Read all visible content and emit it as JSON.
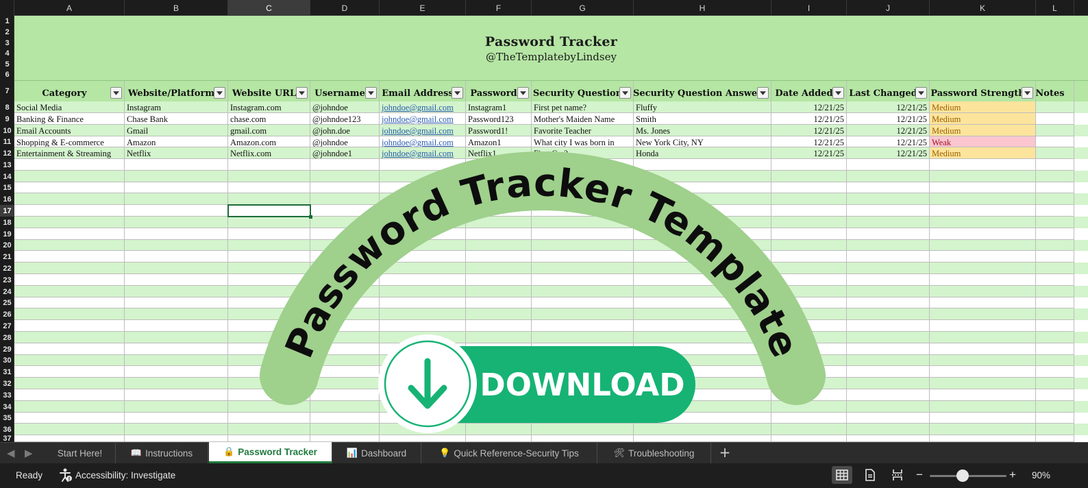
{
  "columns": [
    "A",
    "B",
    "C",
    "D",
    "E",
    "F",
    "G",
    "H",
    "I",
    "J",
    "K",
    "L"
  ],
  "selected_column": "C",
  "selected_row": "17",
  "rows": [
    "1",
    "2",
    "3",
    "4",
    "5",
    "6",
    "7",
    "8",
    "9",
    "10",
    "11",
    "12",
    "13",
    "14",
    "15",
    "16",
    "17",
    "18",
    "19",
    "20",
    "21",
    "22",
    "23",
    "24",
    "25",
    "26",
    "27",
    "28",
    "29",
    "30",
    "31",
    "32",
    "33",
    "34",
    "35",
    "36",
    "37"
  ],
  "sheet_title": "Password Tracker",
  "sheet_subtitle": "@TheTemplatebyLindsey",
  "table": {
    "headers": [
      "Category",
      "Website/Platform",
      "Website URL",
      "Username",
      "Email Address",
      "Password",
      "Security Question",
      "Security Question Answer",
      "Date Added",
      "Last Changed",
      "Password Strength",
      "Notes"
    ],
    "rows": [
      [
        "Social Media",
        "Instagram",
        "Instagram.com",
        "@johndoe",
        "johndoe@gmail.com",
        "Instagram1",
        "First pet name?",
        "Fluffy",
        "12/21/25",
        "12/21/25",
        "Medium",
        ""
      ],
      [
        "Banking & Finance",
        "Chase Bank",
        "chase.com",
        "@johndoe123",
        "johndoe@gmail.com",
        "Password123",
        "Mother's Maiden Name",
        "Smith",
        "12/21/25",
        "12/21/25",
        "Medium",
        ""
      ],
      [
        "Email Accounts",
        "Gmail",
        "gmail.com",
        "@john.doe",
        "johndoe@gmail.com",
        "Password1!",
        "Favorite Teacher",
        "Ms. Jones",
        "12/21/25",
        "12/21/25",
        "Medium",
        ""
      ],
      [
        "Shopping & E-commerce",
        "Amazon",
        "Amazon.com",
        "@johndoe",
        "johndoe@gmail.com",
        "Amazon1",
        "What city I was born in",
        "New York City, NY",
        "12/21/25",
        "12/21/25",
        "Weak",
        ""
      ],
      [
        "Entertainment & Streaming",
        "Netflix",
        "Netflix.com",
        "@johndoe1",
        "johndoe@gmail.com",
        "Netflix1",
        "First Car?",
        "Honda",
        "12/21/25",
        "12/21/25",
        "Medium",
        ""
      ]
    ]
  },
  "overlay": {
    "arc_text": "Password Tracker Template",
    "download_label": "DOWNLOAD",
    "arc_color": "#9fd08c",
    "button_color": "#16b374"
  },
  "tabs": [
    {
      "label": "Start Here!",
      "icon": "",
      "icon_name": ""
    },
    {
      "label": "Instructions",
      "icon": "📖",
      "icon_name": "book-icon"
    },
    {
      "label": "Password Tracker",
      "icon": "🔒",
      "icon_name": "lock-icon",
      "active": true
    },
    {
      "label": "Dashboard",
      "icon": "📊",
      "icon_name": "bar-chart-icon"
    },
    {
      "label": "Quick Reference-Security Tips",
      "icon": "💡",
      "icon_name": "lightbulb-icon"
    },
    {
      "label": "Troubleshooting",
      "icon": "🛠",
      "icon_name": "tools-icon"
    }
  ],
  "status": {
    "ready": "Ready",
    "accessibility": "Accessibility: Investigate",
    "zoom": "90%",
    "zoom_minus": "−",
    "zoom_plus": "+"
  },
  "colors": {
    "header_green": "#b5e6a4",
    "row_green": "#d3f4cc",
    "medium_fill": "#fde49c",
    "weak_fill": "#fbc6cf",
    "active_tab": "#1e7a3c"
  }
}
